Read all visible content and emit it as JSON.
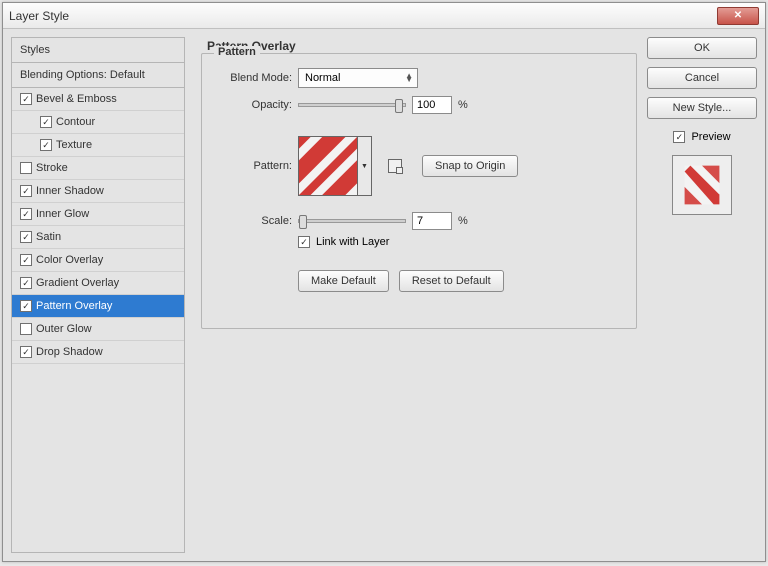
{
  "window": {
    "title": "Layer Style"
  },
  "sidebar": {
    "styles_header": "Styles",
    "blending_header": "Blending Options: Default",
    "items": [
      {
        "label": "Bevel & Emboss",
        "checked": true,
        "indent": false
      },
      {
        "label": "Contour",
        "checked": true,
        "indent": true
      },
      {
        "label": "Texture",
        "checked": true,
        "indent": true
      },
      {
        "label": "Stroke",
        "checked": false,
        "indent": false
      },
      {
        "label": "Inner Shadow",
        "checked": true,
        "indent": false
      },
      {
        "label": "Inner Glow",
        "checked": true,
        "indent": false
      },
      {
        "label": "Satin",
        "checked": true,
        "indent": false
      },
      {
        "label": "Color Overlay",
        "checked": true,
        "indent": false
      },
      {
        "label": "Gradient Overlay",
        "checked": true,
        "indent": false
      },
      {
        "label": "Pattern Overlay",
        "checked": true,
        "indent": false,
        "selected": true
      },
      {
        "label": "Outer Glow",
        "checked": false,
        "indent": false
      },
      {
        "label": "Drop Shadow",
        "checked": true,
        "indent": false
      }
    ]
  },
  "main": {
    "title": "Pattern Overlay",
    "group_label": "Pattern",
    "blend_mode_label": "Blend Mode:",
    "blend_mode_value": "Normal",
    "opacity_label": "Opacity:",
    "opacity_value": "100",
    "opacity_unit": "%",
    "pattern_label": "Pattern:",
    "snap_label": "Snap to Origin",
    "scale_label": "Scale:",
    "scale_value": "7",
    "scale_unit": "%",
    "link_label": "Link with Layer",
    "make_default_label": "Make Default",
    "reset_default_label": "Reset to Default"
  },
  "right": {
    "ok": "OK",
    "cancel": "Cancel",
    "new_style": "New Style...",
    "preview": "Preview"
  },
  "colors": {
    "accent": "#2e7bd1",
    "stripe_red": "#d13a36",
    "stripe_white": "#f3f3f3"
  }
}
